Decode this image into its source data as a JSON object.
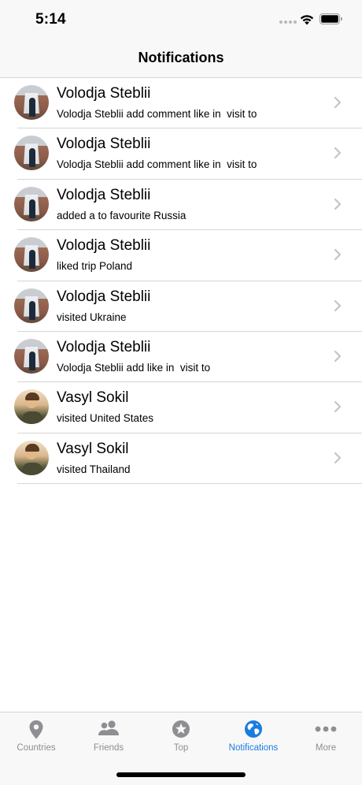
{
  "status_bar": {
    "time": "5:14"
  },
  "header": {
    "title": "Notifications"
  },
  "notifications": [
    {
      "name": "Volodja Steblii",
      "text": "Volodja Steblii add comment like in  visit to",
      "avatar": "volodja"
    },
    {
      "name": "Volodja Steblii",
      "text": "Volodja Steblii add comment like in  visit to",
      "avatar": "volodja"
    },
    {
      "name": "Volodja Steblii",
      "text": "added a to favourite Russia",
      "avatar": "volodja"
    },
    {
      "name": "Volodja Steblii",
      "text": "liked trip Poland",
      "avatar": "volodja"
    },
    {
      "name": "Volodja Steblii",
      "text": "visited Ukraine",
      "avatar": "volodja"
    },
    {
      "name": "Volodja Steblii",
      "text": "Volodja Steblii add like in  visit to",
      "avatar": "volodja"
    },
    {
      "name": "Vasyl Sokil",
      "text": "visited United States",
      "avatar": "vasyl"
    },
    {
      "name": "Vasyl Sokil",
      "text": "visited Thailand",
      "avatar": "vasyl"
    }
  ],
  "tab_bar": {
    "tabs": [
      {
        "label": "Countries",
        "icon": "map-pin-icon",
        "active": false
      },
      {
        "label": "Friends",
        "icon": "people-icon",
        "active": false
      },
      {
        "label": "Top",
        "icon": "star-badge-icon",
        "active": false
      },
      {
        "label": "Notifications",
        "icon": "globe-icon",
        "active": true
      },
      {
        "label": "More",
        "icon": "more-dots-icon",
        "active": false
      }
    ]
  },
  "colors": {
    "accent": "#1a7ce0",
    "inactive": "#8e8e93",
    "separator": "#d6d6d6",
    "bar_background": "#f8f8f8"
  }
}
